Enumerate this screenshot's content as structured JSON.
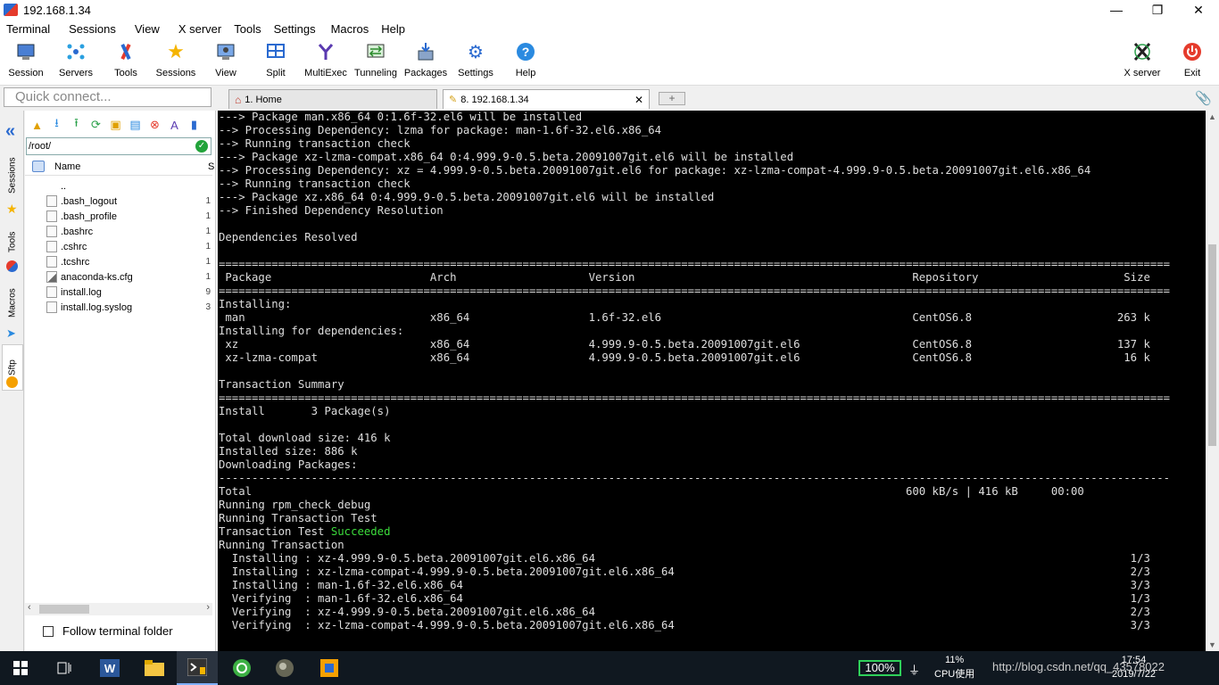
{
  "window": {
    "title": "192.168.1.34"
  },
  "menu": [
    "Terminal",
    "Sessions",
    "View",
    "X server",
    "Tools",
    "Settings",
    "Macros",
    "Help"
  ],
  "toolbar": {
    "buttons": [
      {
        "label": "Session",
        "icon": "session-icon"
      },
      {
        "label": "Servers",
        "icon": "servers-icon"
      },
      {
        "label": "Tools",
        "icon": "tools-icon"
      },
      {
        "label": "Sessions",
        "icon": "star-icon"
      },
      {
        "label": "View",
        "icon": "view-icon"
      },
      {
        "label": "Split",
        "icon": "split-icon"
      },
      {
        "label": "MultiExec",
        "icon": "multiexec-icon"
      },
      {
        "label": "Tunneling",
        "icon": "tunneling-icon"
      },
      {
        "label": "Packages",
        "icon": "packages-icon"
      },
      {
        "label": "Settings",
        "icon": "settings-icon"
      },
      {
        "label": "Help",
        "icon": "help-icon"
      }
    ],
    "xserver_label": "X server",
    "exit_label": "Exit"
  },
  "quick_connect": {
    "placeholder": "Quick connect..."
  },
  "tabs": [
    {
      "label": "1. Home"
    },
    {
      "label": "8. 192.168.1.34"
    }
  ],
  "side_tabs": [
    "Sessions",
    "Tools",
    "Macros",
    "Sftp"
  ],
  "sftp": {
    "path": "/root/",
    "column_name": "Name",
    "column_size_initial": "S",
    "files": [
      {
        "name": "..",
        "size": ""
      },
      {
        "name": ".bash_logout",
        "size": "1"
      },
      {
        "name": ".bash_profile",
        "size": "1"
      },
      {
        "name": ".bashrc",
        "size": "1"
      },
      {
        "name": ".cshrc",
        "size": "1"
      },
      {
        "name": ".tcshrc",
        "size": "1"
      },
      {
        "name": "anaconda-ks.cfg",
        "size": "1"
      },
      {
        "name": "install.log",
        "size": "9"
      },
      {
        "name": "install.log.syslog",
        "size": "3"
      }
    ],
    "follow_label": "Follow terminal folder"
  },
  "terminal": {
    "lines": [
      "---> Package man.x86_64 0:1.6f-32.el6 will be installed",
      "--> Processing Dependency: lzma for package: man-1.6f-32.el6.x86_64",
      "--> Running transaction check",
      "---> Package xz-lzma-compat.x86_64 0:4.999.9-0.5.beta.20091007git.el6 will be installed",
      "--> Processing Dependency: xz = 4.999.9-0.5.beta.20091007git.el6 for package: xz-lzma-compat-4.999.9-0.5.beta.20091007git.el6.x86_64",
      "--> Running transaction check",
      "---> Package xz.x86_64 0:4.999.9-0.5.beta.20091007git.el6 will be installed",
      "--> Finished Dependency Resolution",
      "",
      "Dependencies Resolved",
      "",
      "================================================================================================================================================",
      " Package                        Arch                    Version                                          Repository                      Size",
      "================================================================================================================================================",
      "Installing:",
      " man                            x86_64                  1.6f-32.el6                                      CentOS6.8                      263 k",
      "Installing for dependencies:",
      " xz                             x86_64                  4.999.9-0.5.beta.20091007git.el6                 CentOS6.8                      137 k",
      " xz-lzma-compat                 x86_64                  4.999.9-0.5.beta.20091007git.el6                 CentOS6.8                       16 k",
      "",
      "Transaction Summary",
      "================================================================================================================================================",
      "Install       3 Package(s)",
      "",
      "Total download size: 416 k",
      "Installed size: 886 k",
      "Downloading Packages:",
      "------------------------------------------------------------------------------------------------------------------------------------------------",
      "Total                                                                                                   600 kB/s | 416 kB     00:00",
      "Running rpm_check_debug",
      "Running Transaction Test",
      "Transaction Test ",
      "Running Transaction",
      "  Installing : xz-4.999.9-0.5.beta.20091007git.el6.x86_64                                                                                 1/3",
      "  Installing : xz-lzma-compat-4.999.9-0.5.beta.20091007git.el6.x86_64                                                                     2/3",
      "  Installing : man-1.6f-32.el6.x86_64                                                                                                     3/3",
      "  Verifying  : man-1.6f-32.el6.x86_64                                                                                                     1/3",
      "  Verifying  : xz-4.999.9-0.5.beta.20091007git.el6.x86_64                                                                                 2/3",
      "  Verifying  : xz-lzma-compat-4.999.9-0.5.beta.20091007git.el6.x86_64                                                                     3/3"
    ],
    "succeeded_word": "Succeeded",
    "succeeded_color": "#3cdc3c"
  },
  "taskbar": {
    "battery": "100%",
    "cpu_value": "11%",
    "cpu_label": "CPU使用",
    "tray_text": "http://blog.csdn.net/qq_43578022",
    "time": "17:54",
    "date": "2019/7/22"
  },
  "colors": {
    "accent": "#2a6ad0",
    "terminal_bg": "#000000",
    "terminal_fg": "#dedede"
  }
}
